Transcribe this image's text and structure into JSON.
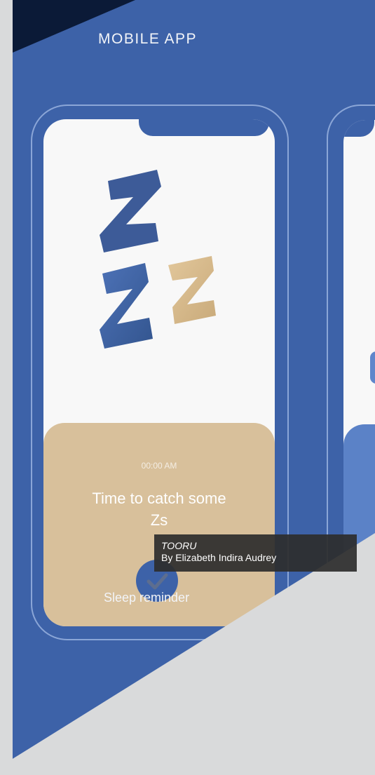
{
  "header": {
    "title": "MOBILE APP"
  },
  "phone": {
    "time": "00:00 AM",
    "message": "Time to catch some Zs"
  },
  "caption": "Sleep reminder",
  "tooltip": {
    "title": "TOORU",
    "author": "By Elizabeth Indira Audrey"
  },
  "colors": {
    "blue": "#3d62a8",
    "dark_navy": "#0b1a37",
    "card_tan": "#d8c09b",
    "light_blue": "#5b82c7"
  },
  "icons": {
    "artwork": "zzz-sleep-icon",
    "confirm": "checkmark-icon"
  }
}
